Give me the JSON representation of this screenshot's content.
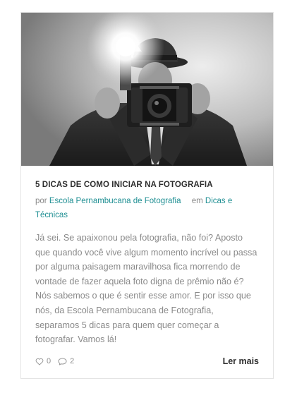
{
  "post": {
    "image_alt": "Fotógrafo com câmera antiga e flash",
    "title": "5 DICAS DE COMO INICIAR NA FOTOGRAFIA",
    "meta": {
      "by_label": "por",
      "author": "Escola Pernambucana de Fotografia",
      "in_label": "em",
      "category": "Dicas e Técnicas"
    },
    "excerpt": "Já sei. Se apaixonou pela fotografia, não foi? Aposto que quando você vive algum momento incrível ou passa por alguma paisagem maravilhosa fica morrendo de vontade de fazer aquela foto digna de prêmio não é? Nós sabemos o que é sentir esse amor. E por isso que nós, da Escola Pernambucana de Fotografia, separamos 5 dicas para quem quer começar a fotografar. Vamos lá!",
    "likes": "0",
    "comments": "2",
    "read_more": "Ler mais"
  },
  "icons": {
    "like": "heart-icon",
    "comment": "comment-bubble-icon"
  },
  "colors": {
    "link": "#1f8f93",
    "title": "#2e2e2e",
    "text": "#8a8a8a"
  }
}
